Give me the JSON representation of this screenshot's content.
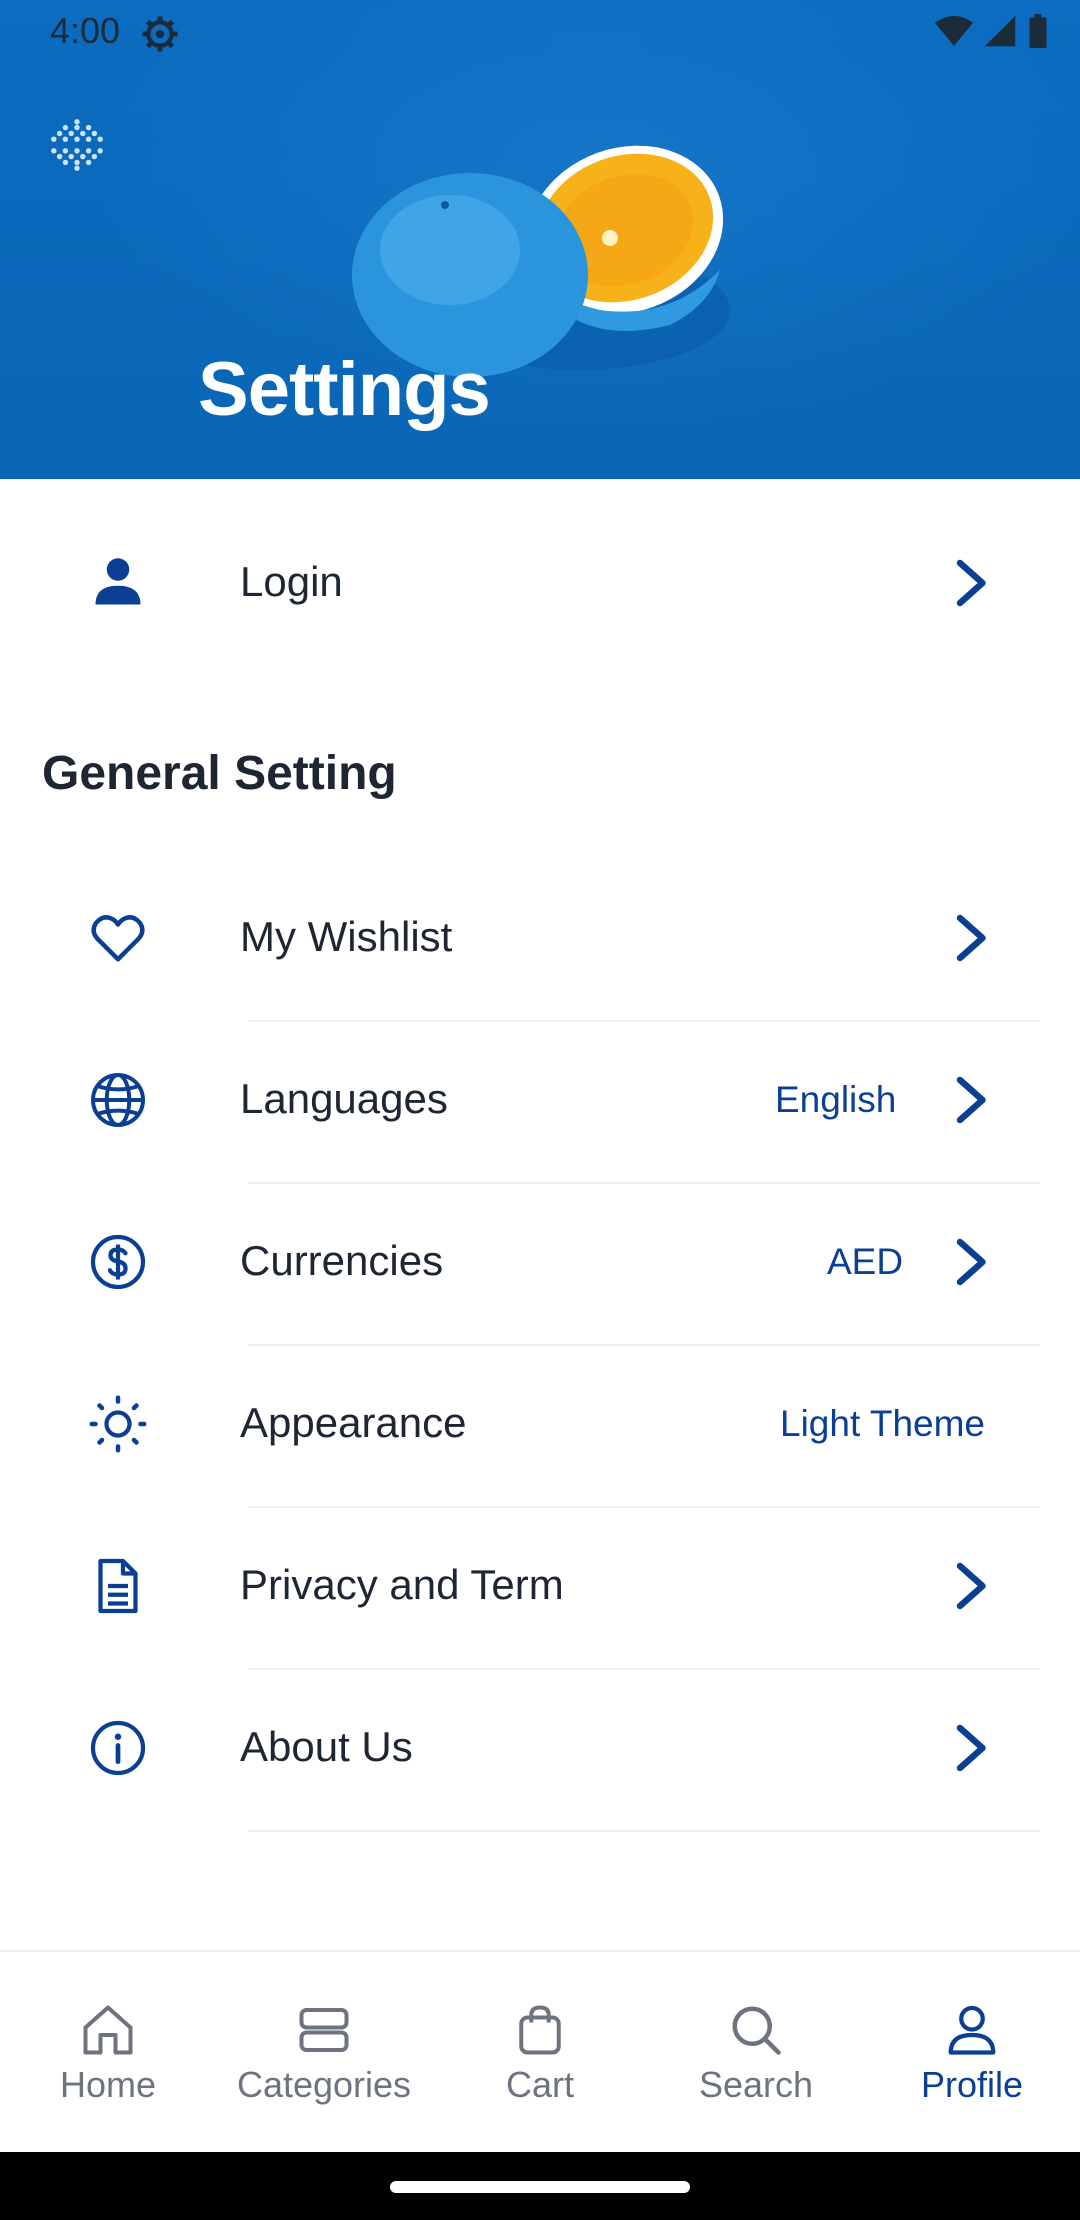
{
  "status_bar": {
    "time": "4:00"
  },
  "header": {
    "title": "Settings"
  },
  "login": {
    "label": "Login"
  },
  "general": {
    "title": "General Setting",
    "items": [
      {
        "label": "My Wishlist",
        "value": "",
        "icon": "heart-icon"
      },
      {
        "label": "Languages",
        "value": "English",
        "icon": "globe-icon"
      },
      {
        "label": "Currencies",
        "value": "AED",
        "icon": "dollar-circle-icon"
      },
      {
        "label": "Appearance",
        "value": "Light Theme",
        "icon": "sun-icon"
      },
      {
        "label": "Privacy and Term",
        "value": "",
        "icon": "document-icon"
      },
      {
        "label": "About Us",
        "value": "",
        "icon": "info-icon"
      }
    ]
  },
  "bottom_nav": {
    "items": [
      {
        "label": "Home",
        "icon": "home-icon",
        "active": false
      },
      {
        "label": "Categories",
        "icon": "categories-icon",
        "active": false
      },
      {
        "label": "Cart",
        "icon": "bag-icon",
        "active": false
      },
      {
        "label": "Search",
        "icon": "search-icon",
        "active": false
      },
      {
        "label": "Profile",
        "icon": "profile-icon",
        "active": true
      }
    ]
  },
  "colors": {
    "header_bg": "#0b6cc0",
    "accent": "#0b3f93",
    "text": "#1e2533",
    "nav_inactive": "#6d7480"
  }
}
